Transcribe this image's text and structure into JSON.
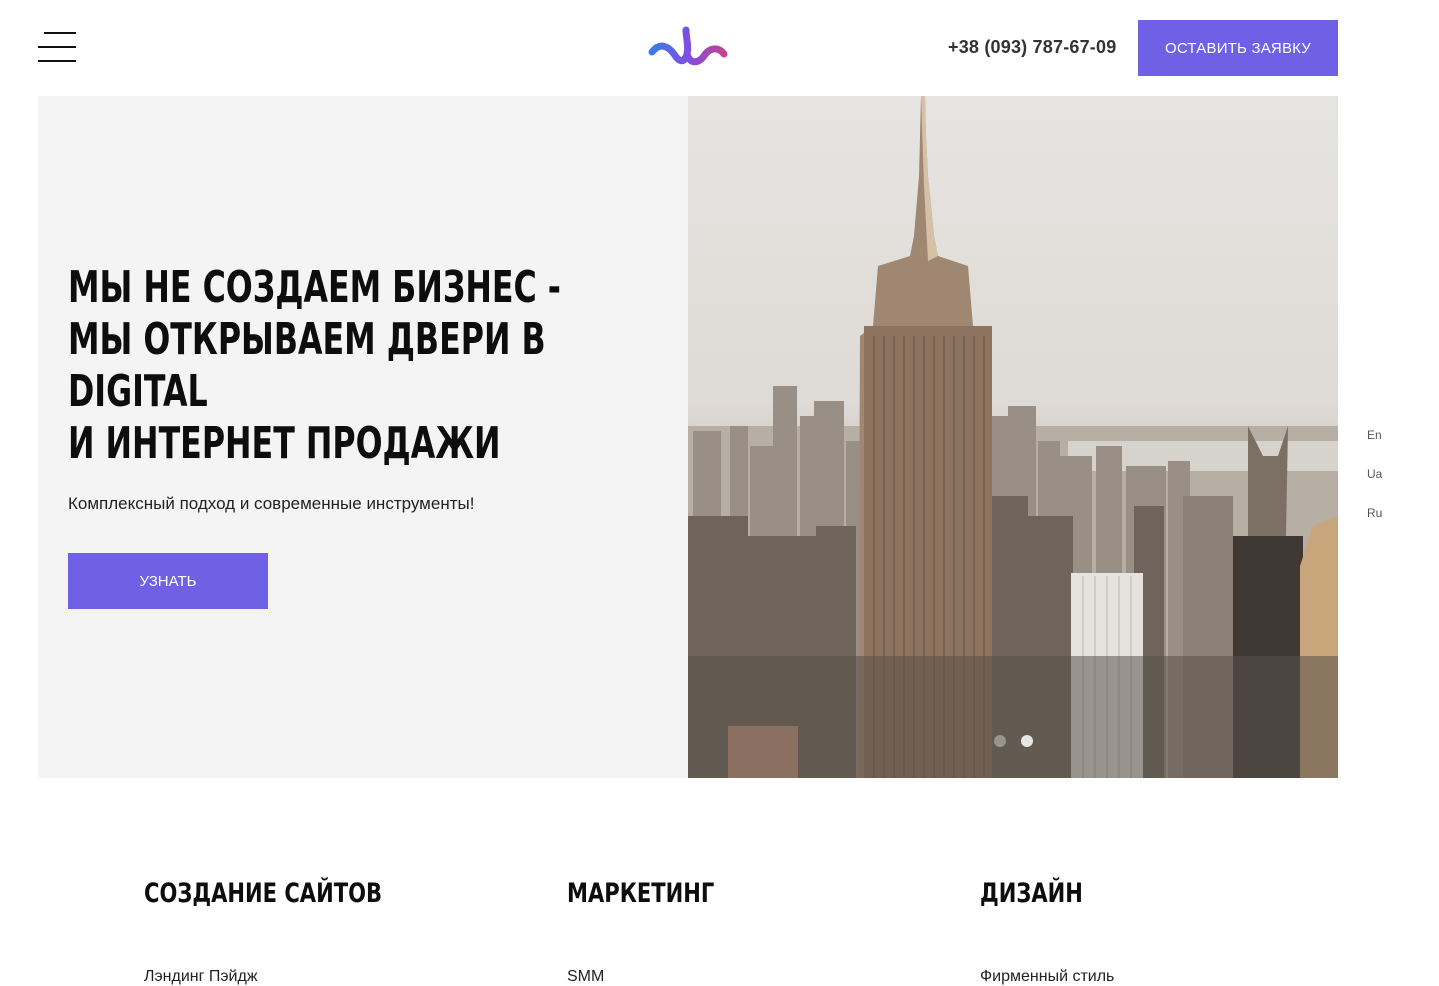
{
  "header": {
    "menu_icon": "hamburger-menu-icon",
    "logo_icon": "wave-logo-icon",
    "phone": "+38 (093) 787-67-09",
    "cta_label": "ОСТАВИТЬ ЗАЯВКУ"
  },
  "hero": {
    "title_lines": [
      "МЫ НЕ СОЗДАЕМ БИЗНЕС -",
      "МЫ ОТКРЫВАЕМ ДВЕРИ В",
      "DIGITAL",
      "И ИНТЕРНЕТ ПРОДАЖИ"
    ],
    "subtitle": "Комплексный подход и современные инструменты!",
    "button_label": "УЗНАТЬ",
    "image": "city-skyline-photo",
    "slider": {
      "slides": 2,
      "active": 2
    }
  },
  "languages": [
    "En",
    "Ua",
    "Ru"
  ],
  "services": [
    {
      "title": "СОЗДАНИЕ САЙТОВ",
      "first_item": "Лэндинг Пэйдж"
    },
    {
      "title": "МАРКЕТИНГ",
      "first_item": "SMM"
    },
    {
      "title": "ДИЗАЙН",
      "first_item": "Фирменный стиль"
    }
  ],
  "colors": {
    "accent": "#6f60e6",
    "hero_bg": "#f4f4f4",
    "text": "#0d0d0d"
  }
}
